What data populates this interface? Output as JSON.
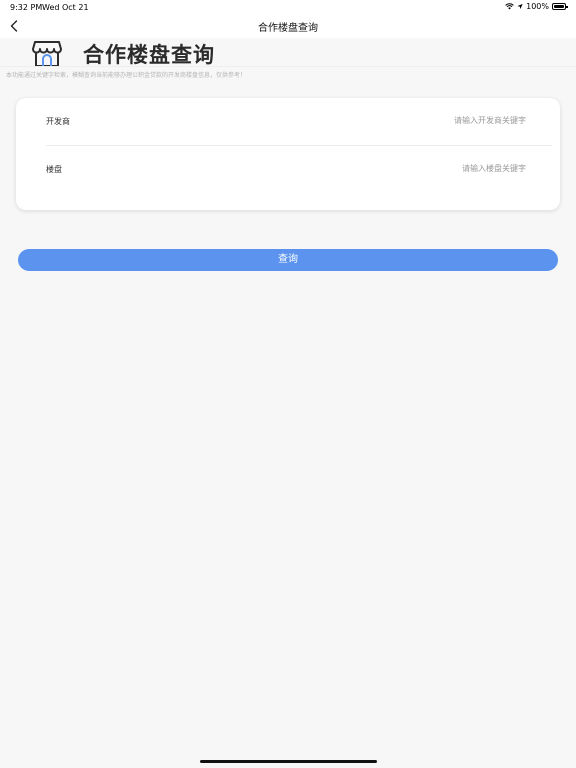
{
  "status_bar": {
    "time": "9:32 PM",
    "date": "Wed Oct 21",
    "battery": "100%"
  },
  "nav": {
    "title": "合作楼盘查询",
    "back_icon": "chevron-left-icon"
  },
  "header": {
    "icon": "store-icon",
    "title": "合作楼盘查询",
    "description": "本功能通过关键字检索，模糊查询当前能够办理公积金贷款的开发商楼盘信息，仅供参考！"
  },
  "form": {
    "developer": {
      "label": "开发商",
      "value": "",
      "placeholder": "请输入开发商关键字"
    },
    "building": {
      "label": "楼盘",
      "value": "",
      "placeholder": "请输入楼盘关键字"
    }
  },
  "actions": {
    "query_label": "查询"
  },
  "colors": {
    "accent": "#5b93ef",
    "background": "#f7f7f7",
    "card": "#ffffff"
  }
}
